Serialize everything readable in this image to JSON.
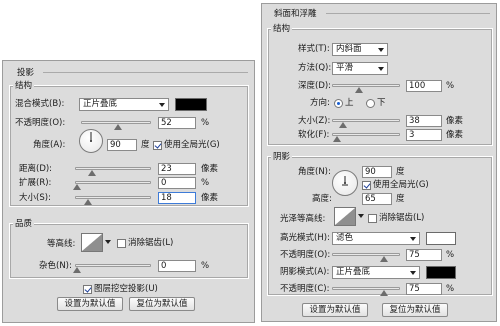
{
  "left": {
    "section_title": "投影",
    "structure": {
      "title": "结构",
      "blend_mode_label": "混合模式(B):",
      "blend_mode_value": "正片叠底",
      "blend_color": "#000000",
      "opacity_label": "不透明度(O):",
      "opacity_value": "52",
      "opacity_unit": "%",
      "opacity_level": 0.52,
      "angle_label": "角度(A):",
      "angle_value": "90",
      "angle_unit": "度",
      "global_light_label": "使用全局光(G)",
      "global_light_checked": true,
      "distance_label": "距离(D):",
      "distance_value": "23",
      "distance_unit": "像素",
      "spread_label": "扩展(R):",
      "spread_value": "0",
      "spread_unit": "%",
      "size_label": "大小(S):",
      "size_value": "18",
      "size_unit": "像素"
    },
    "quality": {
      "title": "品质",
      "contour_label": "等高线:",
      "antialias_label": "消除锯齿(L)",
      "antialias_checked": false,
      "noise_label": "杂色(N):",
      "noise_value": "0",
      "noise_unit": "%",
      "knockout_label": "图层挖空投影(U)",
      "knockout_checked": true
    },
    "buttons": {
      "set_default": "设置为默认值",
      "reset_default": "复位为默认值"
    }
  },
  "right": {
    "section_title": "斜面和浮雕",
    "structure": {
      "title": "结构",
      "style_label": "样式(T):",
      "style_value": "内斜面",
      "technique_label": "方法(Q):",
      "technique_value": "平滑",
      "depth_label": "深度(D):",
      "depth_value": "100",
      "depth_unit": "%",
      "direction_label": "方向:",
      "direction_up": "上",
      "direction_down": "下",
      "direction_selected": "up",
      "size_label": "大小(Z):",
      "size_value": "38",
      "size_unit": "像素",
      "soften_label": "软化(F):",
      "soften_value": "3",
      "soften_unit": "像素"
    },
    "shading": {
      "title": "阴影",
      "angle_label": "角度(N):",
      "angle_value": "90",
      "angle_unit": "度",
      "global_light_label": "使用全局光(G)",
      "global_light_checked": true,
      "altitude_label": "高度:",
      "altitude_value": "65",
      "altitude_unit": "度",
      "gloss_label": "光泽等高线:",
      "antialias_label": "消除锯齿(L)",
      "antialias_checked": false,
      "highlight_mode_label": "高光模式(H):",
      "highlight_mode_value": "滤色",
      "highlight_color": "#ffffff",
      "highlight_opacity_label": "不透明度(O):",
      "highlight_opacity_value": "75",
      "highlight_opacity_unit": "%",
      "shadow_mode_label": "阴影模式(A):",
      "shadow_mode_value": "正片叠底",
      "shadow_color": "#000000",
      "shadow_opacity_label": "不透明度(C):",
      "shadow_opacity_value": "75",
      "shadow_opacity_unit": "%"
    },
    "buttons": {
      "set_default": "设置为默认值",
      "reset_default": "复位为默认值"
    }
  }
}
